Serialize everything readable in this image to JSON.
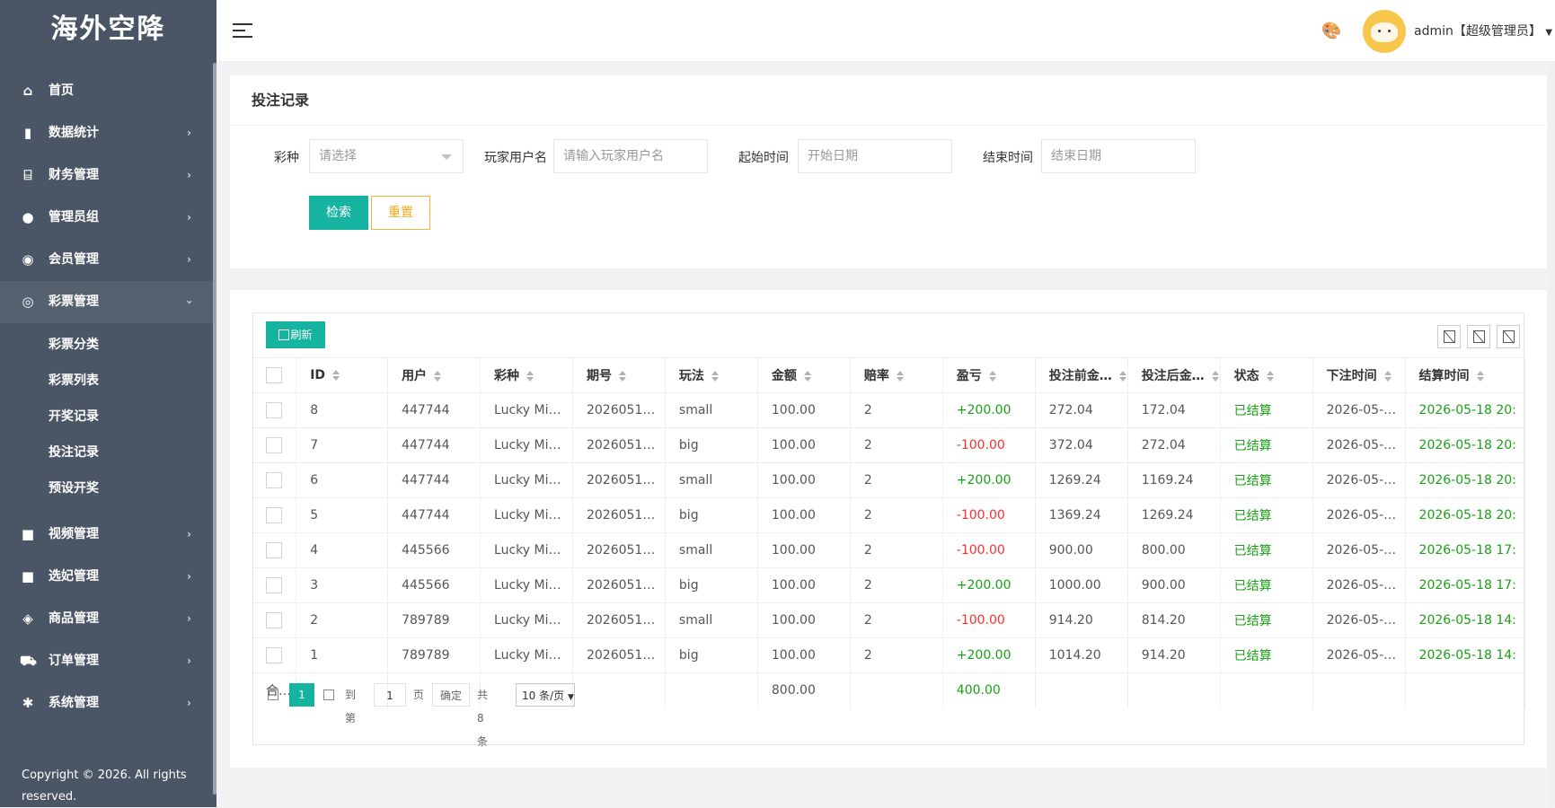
{
  "brand": "海外空降",
  "sidebar": {
    "items": [
      {
        "label": "首页",
        "icon": "home-icon",
        "glyph": "⌂",
        "has_children": false
      },
      {
        "label": "数据统计",
        "icon": "bar-chart-icon",
        "glyph": "▮",
        "has_children": true
      },
      {
        "label": "财务管理",
        "icon": "bank-icon",
        "glyph": "⌸",
        "has_children": true
      },
      {
        "label": "管理员组",
        "icon": "user-icon",
        "glyph": "●",
        "has_children": true
      },
      {
        "label": "会员管理",
        "icon": "users-icon",
        "glyph": "◉",
        "has_children": true
      },
      {
        "label": "彩票管理",
        "icon": "gamepad-icon",
        "glyph": "◎",
        "has_children": true,
        "open": true,
        "children": [
          "彩票分类",
          "彩票列表",
          "开奖记录",
          "投注记录",
          "预设开奖"
        ]
      },
      {
        "label": "视频管理",
        "icon": "video-icon",
        "glyph": "■",
        "has_children": true
      },
      {
        "label": "选妃管理",
        "icon": "video-icon",
        "glyph": "■",
        "has_children": true
      },
      {
        "label": "商品管理",
        "icon": "cube-icon",
        "glyph": "◈",
        "has_children": true
      },
      {
        "label": "订单管理",
        "icon": "cart-icon",
        "glyph": "⛟",
        "has_children": true
      },
      {
        "label": "系统管理",
        "icon": "gear-icon",
        "glyph": "✱",
        "has_children": true
      }
    ],
    "copyright": "Copyright © 2026. All rights reserved."
  },
  "header": {
    "user": "admin【超级管理员】"
  },
  "search": {
    "title": "投注记录",
    "lottery_label": "彩种",
    "lottery_placeholder": "请选择",
    "username_label": "玩家用户名",
    "username_placeholder": "请输入玩家用户名",
    "start_label": "起始时间",
    "start_placeholder": "开始日期",
    "end_label": "结束时间",
    "end_placeholder": "结束日期",
    "search_btn": "检索",
    "reset_btn": "重置"
  },
  "table": {
    "refresh_label": "刷新",
    "columns": [
      "ID",
      "用户",
      "彩种",
      "期号",
      "玩法",
      "金额",
      "赔率",
      "盈亏",
      "投注前金…",
      "投注后金…",
      "状态",
      "下注时间",
      "结算时间"
    ],
    "rows": [
      {
        "id": "8",
        "user": "447744",
        "lottery": "Lucky Mi…",
        "period": "2026051…",
        "play": "small",
        "amount": "100.00",
        "odds": "2",
        "profit": "+200.00",
        "before": "272.04",
        "after": "172.04",
        "status": "已结算",
        "bet_time": "2026-05-…",
        "settle_time": "2026-05-18 20:"
      },
      {
        "id": "7",
        "user": "447744",
        "lottery": "Lucky Mi…",
        "period": "2026051…",
        "play": "big",
        "amount": "100.00",
        "odds": "2",
        "profit": "-100.00",
        "before": "372.04",
        "after": "272.04",
        "status": "已结算",
        "bet_time": "2026-05-…",
        "settle_time": "2026-05-18 20:"
      },
      {
        "id": "6",
        "user": "447744",
        "lottery": "Lucky Mi…",
        "period": "2026051…",
        "play": "small",
        "amount": "100.00",
        "odds": "2",
        "profit": "+200.00",
        "before": "1269.24",
        "after": "1169.24",
        "status": "已结算",
        "bet_time": "2026-05-…",
        "settle_time": "2026-05-18 20:"
      },
      {
        "id": "5",
        "user": "447744",
        "lottery": "Lucky Mi…",
        "period": "2026051…",
        "play": "big",
        "amount": "100.00",
        "odds": "2",
        "profit": "-100.00",
        "before": "1369.24",
        "after": "1269.24",
        "status": "已结算",
        "bet_time": "2026-05-…",
        "settle_time": "2026-05-18 20:"
      },
      {
        "id": "4",
        "user": "445566",
        "lottery": "Lucky Mi…",
        "period": "2026051…",
        "play": "small",
        "amount": "100.00",
        "odds": "2",
        "profit": "-100.00",
        "before": "900.00",
        "after": "800.00",
        "status": "已结算",
        "bet_time": "2026-05-…",
        "settle_time": "2026-05-18 17:"
      },
      {
        "id": "3",
        "user": "445566",
        "lottery": "Lucky Mi…",
        "period": "2026051…",
        "play": "big",
        "amount": "100.00",
        "odds": "2",
        "profit": "+200.00",
        "before": "1000.00",
        "after": "900.00",
        "status": "已结算",
        "bet_time": "2026-05-…",
        "settle_time": "2026-05-18 17:"
      },
      {
        "id": "2",
        "user": "789789",
        "lottery": "Lucky Mi…",
        "period": "2026051…",
        "play": "small",
        "amount": "100.00",
        "odds": "2",
        "profit": "-100.00",
        "before": "914.20",
        "after": "814.20",
        "status": "已结算",
        "bet_time": "2026-05-…",
        "settle_time": "2026-05-18 14:"
      },
      {
        "id": "1",
        "user": "789789",
        "lottery": "Lucky Mi…",
        "period": "2026051…",
        "play": "big",
        "amount": "100.00",
        "odds": "2",
        "profit": "+200.00",
        "before": "1014.20",
        "after": "914.20",
        "status": "已结算",
        "bet_time": "2026-05-…",
        "settle_time": "2026-05-18 14:"
      }
    ],
    "total": {
      "label": "合…",
      "amount": "800.00",
      "profit": "400.00"
    }
  },
  "pager": {
    "current": "1",
    "goto_label": "到第",
    "page_input": "1",
    "page_suffix": "页",
    "confirm": "确定",
    "total": "共 8 条",
    "page_size": "10 条/页"
  },
  "colors": {
    "accent": "#16b3a0",
    "warning": "#f0a81e",
    "positive": "#1aa016",
    "negative": "#ff2d2d",
    "sidebar": "#4a5665"
  }
}
